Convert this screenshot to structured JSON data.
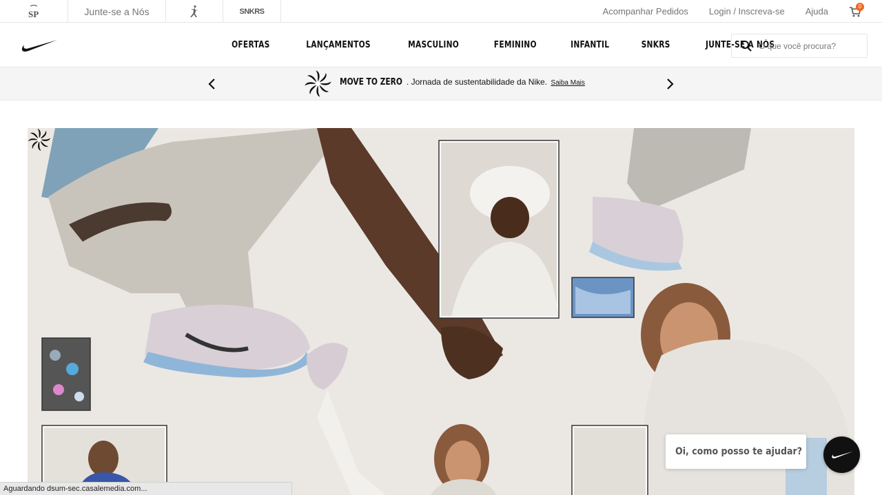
{
  "topbar": {
    "sp_logo": "SP",
    "join_label": "Junte-se a Nós",
    "jordan_icon": "jumpman-icon",
    "snkrs_label": "SNKRS",
    "links": [
      "Acompanhar Pedidos",
      "Login / Inscreva-se",
      "Ajuda"
    ],
    "cart_count": "0"
  },
  "nav": {
    "logo": "nike-swoosh-icon",
    "items": [
      "OFERTAS",
      "LANÇAMENTOS",
      "MASCULINO",
      "FEMININO",
      "INFANTIL",
      "SNKRS",
      "JUNTE-SE A NÓS"
    ],
    "search_placeholder": "O que você procura?"
  },
  "promo": {
    "strong": "MOVE TO ZERO",
    "text": ". Jornada de sustentabilidade da Nike.",
    "link": "Saiba Mais"
  },
  "hero": {
    "background_color": "#eceae6",
    "badge_icon": "move-to-zero-icon"
  },
  "chat": {
    "bubble_text": "Oi, como posso te ajudar?"
  },
  "status_bar": {
    "text": "Aguardando dsum-sec.casalemedia.com..."
  },
  "colors": {
    "accent_badge": "#f26722",
    "text_primary": "#111111",
    "text_muted": "#757575"
  }
}
